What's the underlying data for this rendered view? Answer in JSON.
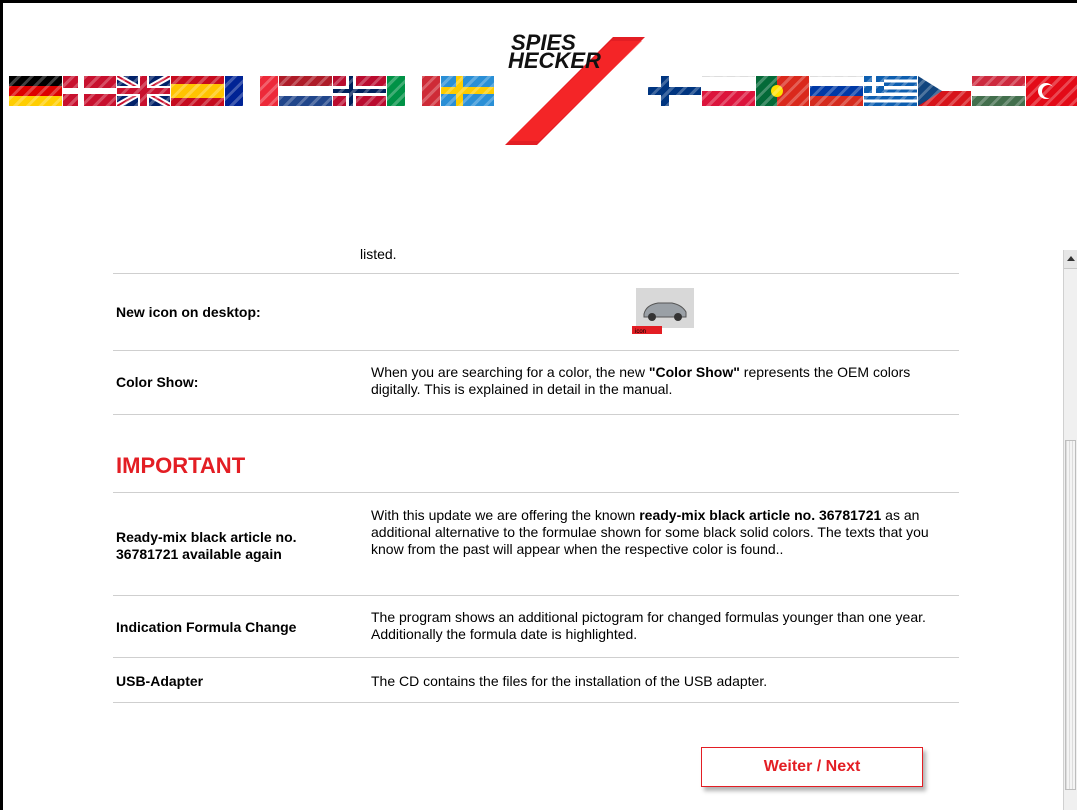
{
  "header": {
    "brand_line1": "SPIES",
    "brand_line2": "HECKER",
    "flags_left": [
      "germany-flag",
      "denmark-flag",
      "uk-flag",
      "spain-flag",
      "france-flag",
      "netherlands-flag",
      "norway-flag",
      "italy-flag",
      "sweden-flag"
    ],
    "flags_right": [
      "finland-flag",
      "poland-flag",
      "portugal-flag",
      "russia-flag",
      "greece-flag",
      "czech-flag",
      "hungary-flag",
      "turkey-flag"
    ]
  },
  "partial_text": "listed.",
  "rows": [
    {
      "label": "New icon on desktop:",
      "icon": "car-desktop-icon",
      "icon_caption": "icon"
    },
    {
      "label": "Color Show:",
      "desc_a": "When you are searching for a color, the new ",
      "desc_b": "\"Color Show\"",
      "desc_c": " represents the OEM colors digitally. This is explained in detail in the manual."
    }
  ],
  "important_heading": "IMPORTANT",
  "important_rows": [
    {
      "label": "Ready-mix black article no. 36781721 available again",
      "desc_a": "With this update we are offering the known ",
      "desc_b": "ready-mix black article no. 36781721",
      "desc_c": " as an additional alternative to the formulae shown for some black solid colors. The texts that you know from the past will appear when the respective color is found.."
    },
    {
      "label": "Indication Formula Change",
      "desc": "The program shows an additional pictogram for changed formulas younger than one year. Additionally the formula date is highlighted."
    },
    {
      "label": "USB-Adapter",
      "desc": "The CD contains the files for the installation of the USB adapter."
    }
  ],
  "next_button": "Weiter / Next",
  "colors": {
    "accent": "#e31e24"
  }
}
